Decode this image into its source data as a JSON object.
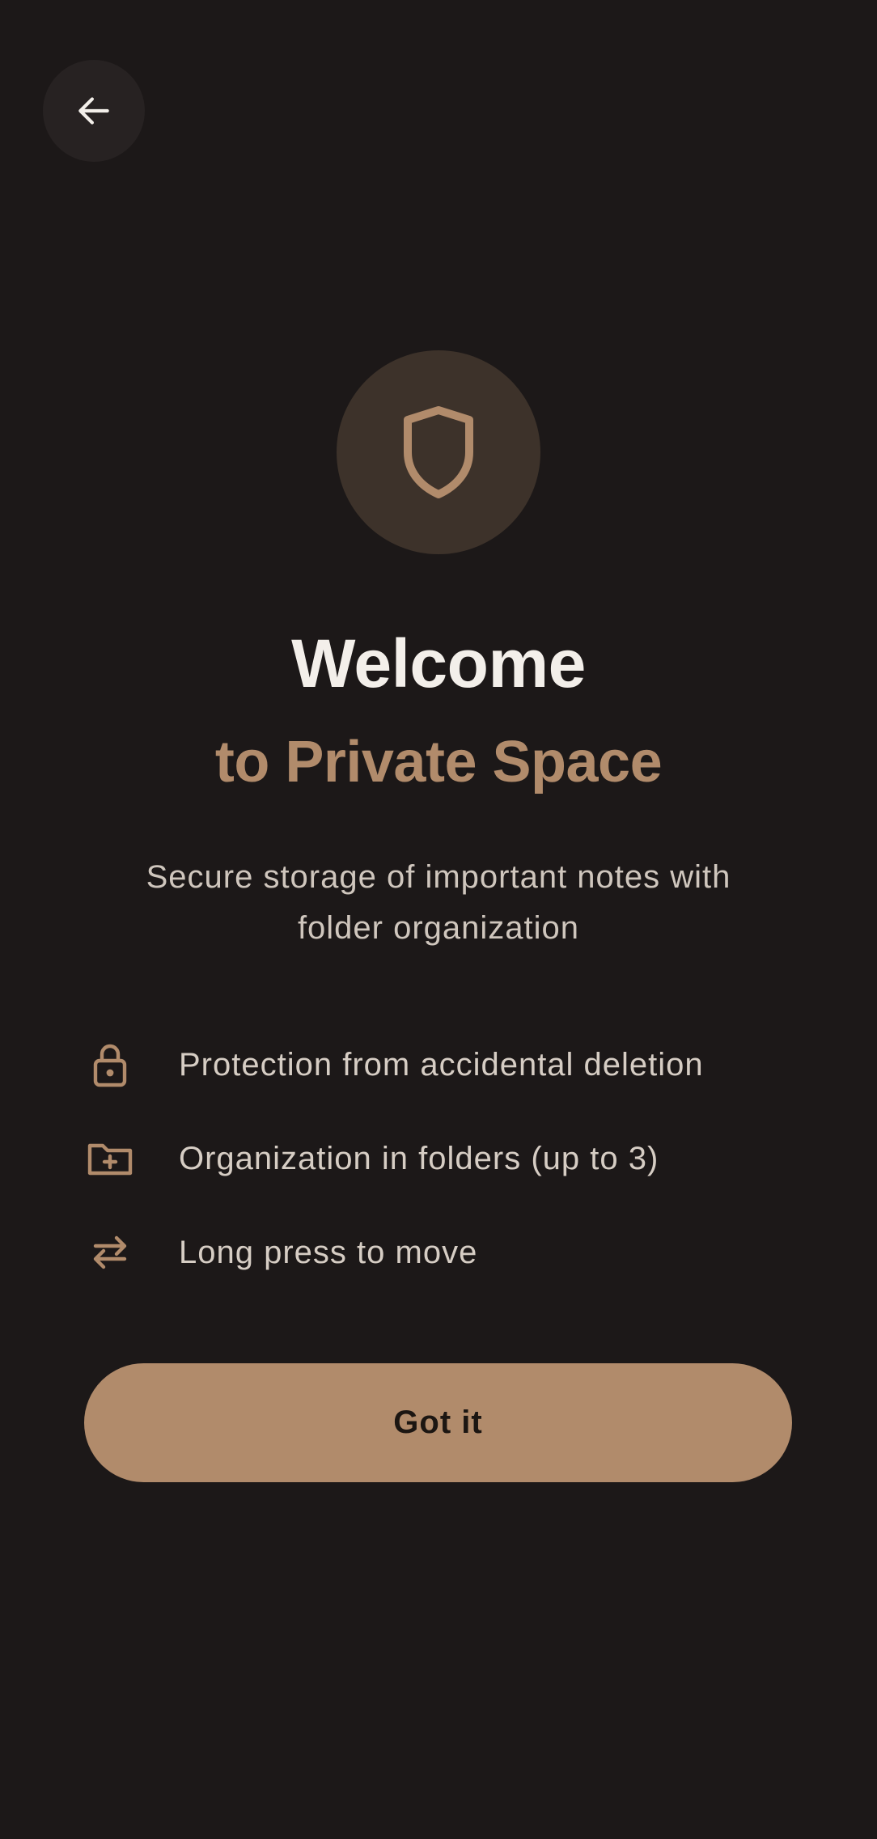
{
  "screen": {
    "background": "#1c1818",
    "accent": "#b18b6b"
  },
  "header": {
    "back_icon": "arrow-left-icon"
  },
  "hero": {
    "icon": "shield-icon",
    "title": "Welcome",
    "title_accent": "to Private Space",
    "subtitle": "Secure storage of important notes with folder organization"
  },
  "features": [
    {
      "icon": "lock-icon",
      "label": "Protection from accidental deletion"
    },
    {
      "icon": "folder-plus-icon",
      "label": "Organization in folders (up to 3)"
    },
    {
      "icon": "swap-arrows-icon",
      "label": "Long press to move"
    }
  ],
  "action": {
    "label": "Got it"
  }
}
